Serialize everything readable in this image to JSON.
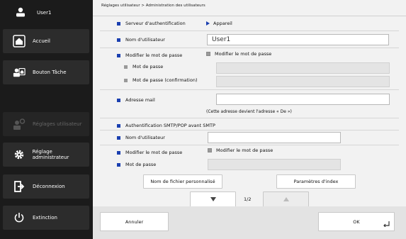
{
  "sidebar": {
    "user": "User1",
    "items": [
      {
        "label": "Accueil",
        "icon": "home-icon"
      },
      {
        "label": "Bouton Tâche",
        "icon": "task-icon"
      },
      {
        "label": "Réglages utilisateur",
        "icon": "user-settings-icon",
        "disabled": true
      },
      {
        "label": "Réglage administrateur",
        "icon": "gear-icon"
      },
      {
        "label": "Déconnexion",
        "icon": "logout-icon"
      },
      {
        "label": "Extinction",
        "icon": "power-icon"
      }
    ]
  },
  "breadcrumb": "Réglages utilisateur > Administration des utilisateurs",
  "form": {
    "auth_server_label": "Serveur d'authentification",
    "auth_server_value": "Appareil",
    "username_label": "Nom d'utilisateur",
    "username_value": "User1",
    "change_password_label": "Modifier le mot de passe",
    "change_password_check": "Modifier le mot de passe",
    "password_label": "Mot de passe",
    "password_confirm_label": "Mot de passe (confirmation)",
    "email_label": "Adresse mail",
    "email_note": "(Cette adresse devient l'adresse « De »)",
    "smtp_section_label": "Authentification SMTP/POP avant SMTP",
    "smtp_username_label": "Nom d'utilisateur",
    "smtp_change_password_label": "Modifier le mot de passe",
    "smtp_change_password_check": "Modifier le mot de passe",
    "smtp_password_label": "Mot de passe"
  },
  "buttons": {
    "custom_filename": "Nom de fichier personnalisé",
    "index_params": "Paramètres d'index",
    "page_indicator": "1/2",
    "cancel": "Annuler",
    "ok": "OK"
  },
  "colors": {
    "accent": "#1a3fb0",
    "sidebar_bg": "#1b1b1b"
  }
}
